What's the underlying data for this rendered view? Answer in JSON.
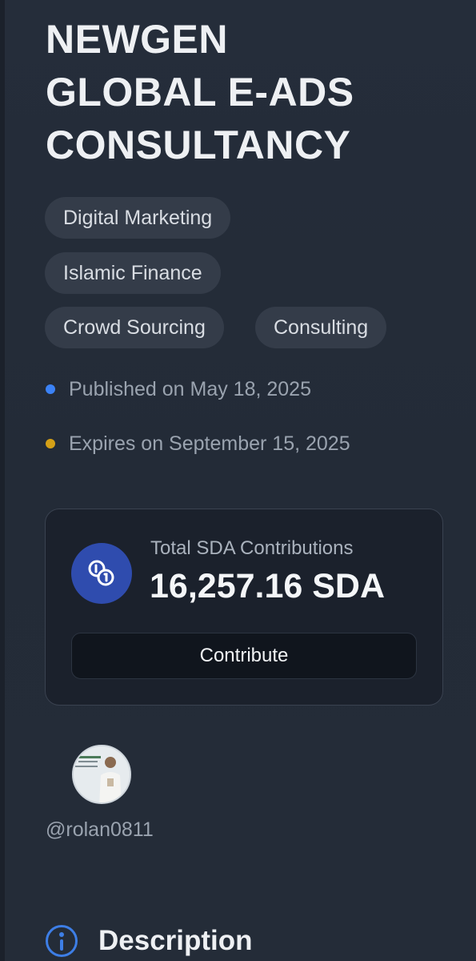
{
  "header": {
    "title_line1": "NEWGEN",
    "title_line2": "GLOBAL E-ADS",
    "title_line3": "CONSULTANCY"
  },
  "tags": [
    "Digital Marketing",
    "Islamic Finance",
    "Crowd Sourcing",
    "Consulting"
  ],
  "meta": {
    "published": "Published on May 18, 2025",
    "expires": "Expires on September 15, 2025",
    "published_dot_color": "#3b82f6",
    "expires_dot_color": "#d4a017"
  },
  "contributions": {
    "label": "Total SDA Contributions",
    "value": "16,257.16 SDA",
    "button_label": "Contribute",
    "icon": "coins-icon"
  },
  "author": {
    "username": "@rolan0811",
    "avatar_icon": "user-avatar"
  },
  "section": {
    "title": "Description",
    "icon": "info-icon"
  },
  "colors": {
    "background": "#232b37",
    "accent_blue": "#2f4cae",
    "chip": "#343c49"
  }
}
